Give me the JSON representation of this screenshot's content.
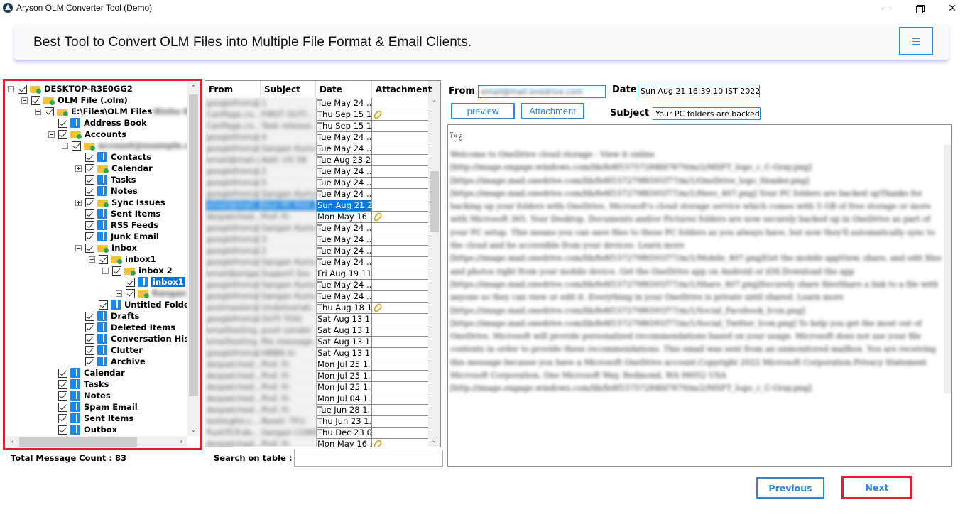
{
  "window": {
    "title": "Aryson OLM Converter Tool (Demo)",
    "controls": [
      "minimize",
      "restore",
      "close"
    ]
  },
  "banner": {
    "text": "Best Tool to Convert OLM Files into Multiple File Format & Email Clients.",
    "menu_icon": "hamburger-icon"
  },
  "colors": {
    "accent": "#2e86d6",
    "highlight_border": "#e02030",
    "selection": "#0a78d7",
    "folder": "#f2c23c",
    "book": "#1e88e5"
  },
  "tree": {
    "items": [
      {
        "label": "DESKTOP-R3E0GG2",
        "icon": "folder-icon",
        "expander": "minus",
        "level": 0
      },
      {
        "label": "OLM File (.olm)",
        "icon": "folder-icon",
        "expander": "minus",
        "level": 1
      },
      {
        "label": "E:\\Files\\OLM Files",
        "blurred_suffix": "\\Rishu Kum",
        "icon": "folder-icon",
        "expander": "minus",
        "level": 2
      },
      {
        "label": "Address Book",
        "icon": "book-icon",
        "level": 3
      },
      {
        "label": "Accounts",
        "icon": "folder-icon",
        "expander": "minus",
        "level": 3
      },
      {
        "label": "account@example.com",
        "blurred": true,
        "icon": "folder-icon",
        "expander": "minus",
        "level": 4
      },
      {
        "label": "Contacts",
        "icon": "book-icon",
        "level": 5
      },
      {
        "label": "Calendar",
        "icon": "folder-icon",
        "expander": "plus",
        "level": 5
      },
      {
        "label": "Tasks",
        "icon": "book-icon",
        "level": 5
      },
      {
        "label": "Notes",
        "icon": "book-icon",
        "level": 5
      },
      {
        "label": "Sync Issues",
        "icon": "folder-icon",
        "expander": "plus",
        "level": 5
      },
      {
        "label": "Sent Items",
        "icon": "book-icon",
        "level": 5
      },
      {
        "label": "RSS Feeds",
        "icon": "book-icon",
        "level": 5
      },
      {
        "label": "Junk Email",
        "icon": "book-icon",
        "level": 5
      },
      {
        "label": "Inbox",
        "icon": "folder-icon",
        "expander": "minus",
        "level": 5
      },
      {
        "label": "inbox1",
        "icon": "folder-icon",
        "expander": "minus",
        "level": 6
      },
      {
        "label": "inbox 2",
        "icon": "folder-icon",
        "expander": "minus",
        "level": 7
      },
      {
        "label": "inbox1",
        "icon": "book-icon",
        "level": 8,
        "selected": true
      },
      {
        "label": "Rangan",
        "blurred": true,
        "icon": "folder-icon",
        "expander": "plus",
        "level": 8
      },
      {
        "label": "Untitled Folder",
        "icon": "book-icon",
        "level": 6
      },
      {
        "label": "Drafts",
        "icon": "book-icon",
        "level": 5
      },
      {
        "label": "Deleted Items",
        "icon": "book-icon",
        "level": 5
      },
      {
        "label": "Conversation History",
        "icon": "book-icon",
        "level": 5
      },
      {
        "label": "Clutter",
        "icon": "book-icon",
        "level": 5
      },
      {
        "label": "Archive",
        "icon": "book-icon",
        "level": 5
      },
      {
        "label": "Calendar",
        "icon": "book-icon",
        "level": 3
      },
      {
        "label": "Tasks",
        "icon": "book-icon",
        "level": 3
      },
      {
        "label": "Notes",
        "icon": "book-icon",
        "level": 3
      },
      {
        "label": "Spam Email",
        "icon": "book-icon",
        "level": 3
      },
      {
        "label": "Sent Items",
        "icon": "book-icon",
        "level": 3
      },
      {
        "label": "Outbox",
        "icon": "book-icon",
        "level": 3
      }
    ],
    "total_message_count_label": "Total Message Count : 83"
  },
  "table": {
    "columns": [
      "From",
      "Subject",
      "Date",
      "Attachment"
    ],
    "rows": [
      {
        "from": "googlefrom@...",
        "subject": "1",
        "date": "Tue May 24 ...",
        "attachment": false
      },
      {
        "from": "CanPage.co...",
        "subject": "FIRST GUTI...",
        "date": "Thu Sep 15 1...",
        "attachment": true
      },
      {
        "from": "CanPage.co...",
        "subject": "Task release...",
        "date": "Thu Sep 15 1...",
        "attachment": false
      },
      {
        "from": "googlefrom@...",
        "subject": "4",
        "date": "Tue May 24 ...",
        "attachment": false
      },
      {
        "from": "googlefrom@...",
        "subject": "Sangan Kumar",
        "date": "Tue May 24 ...",
        "attachment": false
      },
      {
        "from": "email@mail.c...",
        "subject": "Add: US 58",
        "date": "Tue Aug 23 2...",
        "attachment": false
      },
      {
        "from": "googlefrom@...",
        "subject": "2",
        "date": "Tue May 24 ...",
        "attachment": false
      },
      {
        "from": "googlefrom@...",
        "subject": "5",
        "date": "Tue May 24 ...",
        "attachment": false
      },
      {
        "from": "googlefrom@...",
        "subject": "Sangan Kumar",
        "date": "Tue May 24 ...",
        "attachment": false
      },
      {
        "from": "email@mail...",
        "subject": "Your PC fold...",
        "date": "Sun Aug 21 2...",
        "attachment": false,
        "selected": true
      },
      {
        "from": "despatched...",
        "subject": "Prof. Fr.",
        "date": "Mon May 16 ...",
        "attachment": true
      },
      {
        "from": "googlefrom@...",
        "subject": "Sangan Kumar",
        "date": "Tue May 24 ...",
        "attachment": false
      },
      {
        "from": "googlefrom@...",
        "subject": "3",
        "date": "Tue May 24 ...",
        "attachment": false
      },
      {
        "from": "googlefrom@...",
        "subject": "2",
        "date": "Tue May 24 ...",
        "attachment": false
      },
      {
        "from": "googlefrom@...",
        "subject": "Sangan Kumar",
        "date": "Tue May 24 ...",
        "attachment": false
      },
      {
        "from": "email@engag...",
        "subject": "Support Soc",
        "date": "Fri Aug 19 11...",
        "attachment": false
      },
      {
        "from": "googlefrom@...",
        "subject": "Sangan Kumar",
        "date": "Tue May 24 ...",
        "attachment": false
      },
      {
        "from": "googlefrom@...",
        "subject": "Sangan Kumar",
        "date": "Tue May 24 ...",
        "attachment": false
      },
      {
        "from": "postmaster@...",
        "subject": "Undeliverab...",
        "date": "Thu Aug 18 1...",
        "attachment": true
      },
      {
        "from": "googlefrom@...",
        "subject": "GUTI TOO",
        "date": "Sat Aug 13 1...",
        "attachment": false
      },
      {
        "from": "emailtesting...",
        "subject": "push sender",
        "date": "Sat Aug 13 1...",
        "attachment": false
      },
      {
        "from": "emailtesting...",
        "subject": "file message",
        "date": "Sat Aug 13 1...",
        "attachment": false
      },
      {
        "from": "googlefrom@...",
        "subject": "HBBN In",
        "date": "Sat Aug 13 1...",
        "attachment": false
      },
      {
        "from": "despatched...",
        "subject": "Prof. Fr.",
        "date": "Mon Jul 25 1...",
        "attachment": false
      },
      {
        "from": "despatched...",
        "subject": "Prof. Fr.",
        "date": "Mon Jul 25 1...",
        "attachment": false
      },
      {
        "from": "despatched...",
        "subject": "Prof. Fr.",
        "date": "Mon Jul 25 1...",
        "attachment": false
      },
      {
        "from": "despatched...",
        "subject": "Prof. Fr.",
        "date": "Mon Jul 04 1...",
        "attachment": false
      },
      {
        "from": "despatched...",
        "subject": "Prof. Fr.",
        "date": "Tue Jun 28 1...",
        "attachment": false
      },
      {
        "from": "testingfor.c...",
        "subject": "Reset: TFU",
        "date": "Thu Jun 23 1...",
        "attachment": false
      },
      {
        "from": "PushTCP.de...",
        "subject": "Sangan COMI",
        "date": "Thu Dec 23 0...",
        "attachment": false
      },
      {
        "from": "despatched...",
        "subject": "Prof. Fr.",
        "date": "Mon May 16 ...",
        "attachment": true
      }
    ],
    "search_label": "Search on table :",
    "search_value": "",
    "search_placeholder": ""
  },
  "preview": {
    "from_label": "From",
    "from_value": "email@mail.onedrive.com",
    "date_label": "Date",
    "date_value": "Sun Aug 21 16:39:10 IST 2022",
    "subject_label": "Subject",
    "subject_value": "Your PC folders are backed ...",
    "preview_button": "preview",
    "attachment_button": "Attachment",
    "body_prefix": "ï»¿",
    "body_text": "Welcome to OneDrive cloud storage : View it online [http://image.engage.windows.com/lib/fe8f15757284fd7879/m/2/MSFT_logo_c_C-Gray.png] [https://image.mail.onedrive.com/lib/fe8f157279f6591f77/m/1/OneDrive_logo_Header.png] [https://image.mail.onedrive.com/lib/fe8f157279f6591f77/m/1/Hero_407.png] Your PC folders are backed upThanks for backing up your folders with OneDrive, Microsoft's cloud storage service which comes with 5 GB of free storage or more with Microsoft 365. Your Desktop, Documents and/or Pictures folders are now securely backed up in OneDrive as part of your PC setup. This means you can save files to these PC folders as you always have, but now they'll automatically sync to the cloud and be accessible from your devices. Learn more [https://image.mail.onedrive.com/lib/fe8f157279f6591f77/m/1/Mobile_407.png]Get the mobile appView, share, and edit files and photos right from your mobile device. Get the OneDrive app on Android or iOS.Download the app [https://image.mail.onedrive.com/lib/fe8f157279f6591f77/m/1/Share_407.png]Securely share filesShare a link to a file with anyone so they can view or edit it. Everything in your OneDrive is private until shared. Learn more [https://image.mail.onedrive.com/lib/fe8f157279f6591f77/m/1/Social_Facebook_Icon.png] [https://image.mail.onedrive.com/lib/fe8f157279f6591f77/m/1/Social_Twitter_Icon.png] To help you get the most out of OneDrive, Microsoft will provide personalized recommendations based on your usage. Microsoft does not use your file contents in order to provide these recommendations. This email was sent from an unmonitored mailbox. You are receiving this message because you have a Microsoft OneDrive account.Copyright 2022 Microsoft Corporation.Privacy Statement Microsoft Corporation, One Microsoft Way, Redmond, WA 98052 USA [http://image.engage.windows.com/lib/fe8f15757284fd7879/m/2/MSFT_logo_c_C-Gray.png]"
  },
  "nav": {
    "previous_label": "Previous",
    "next_label": "Next"
  }
}
